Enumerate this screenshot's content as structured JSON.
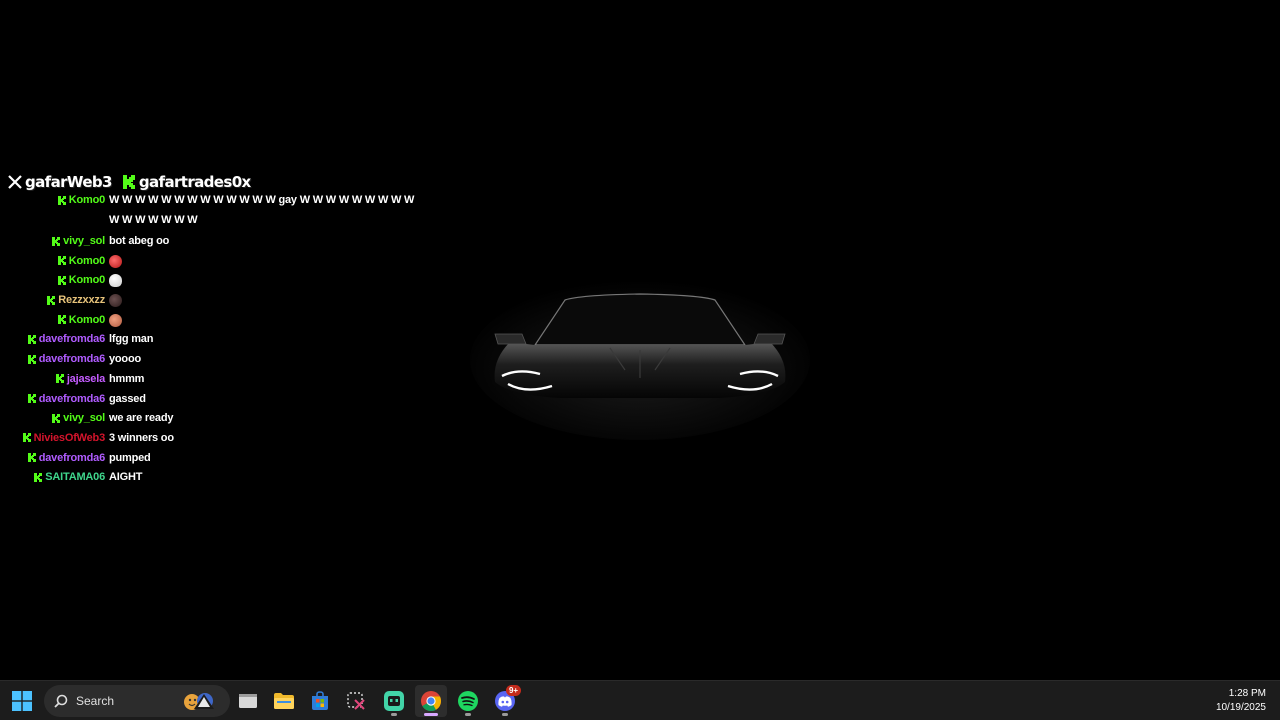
{
  "stream_header": {
    "x_handle": "gafarWeb3",
    "kick_handle": "gafartrades0x",
    "colors": {
      "kick_green": "#53fc18",
      "text": "#ffffff"
    }
  },
  "chat": {
    "messages": [
      {
        "user": "Komo0",
        "color": "#53fc18",
        "text": "W W W W W W W W W W W W W gay W W W W W W W W W",
        "partial": true
      },
      {
        "user": "",
        "color": "#ffffff",
        "text": "W W W W W W W",
        "continuation": true
      },
      {
        "user": "vivy_sol",
        "color": "#53fc18",
        "text": "bot abeg oo"
      },
      {
        "user": "Komo0",
        "color": "#53fc18",
        "text": "",
        "emote": "red-devil-emote"
      },
      {
        "user": "Komo0",
        "color": "#53fc18",
        "text": "",
        "emote": "ghost-emote"
      },
      {
        "user": "Rezzxxzz",
        "color": "#e6c27a",
        "text": "",
        "emote": "dark-face-emote"
      },
      {
        "user": "Komo0",
        "color": "#53fc18",
        "text": "",
        "emote": "face-emote"
      },
      {
        "user": "davefromda6",
        "color": "#b05cff",
        "text": "lfgg man"
      },
      {
        "user": "davefromda6",
        "color": "#b05cff",
        "text": "yoooo"
      },
      {
        "user": "jajasela",
        "color": "#c45cff",
        "text": "hmmm"
      },
      {
        "user": "davefromda6",
        "color": "#b05cff",
        "text": "gassed"
      },
      {
        "user": "vivy_sol",
        "color": "#53fc18",
        "text": "we are ready"
      },
      {
        "user": "NiviesOfWeb3",
        "color": "#d4142c",
        "text": "3 winners oo"
      },
      {
        "user": "davefromda6",
        "color": "#b05cff",
        "text": "pumped"
      },
      {
        "user": "SAITAMA06",
        "color": "#3fd68c",
        "text": "AIGHT"
      }
    ]
  },
  "taskbar": {
    "search_placeholder": "Search",
    "apps": [
      {
        "name": "file-explorer-window"
      },
      {
        "name": "file-explorer"
      },
      {
        "name": "microsoft-store"
      },
      {
        "name": "snipping-tool"
      },
      {
        "name": "app-running"
      },
      {
        "name": "chrome",
        "active": true
      },
      {
        "name": "spotify"
      },
      {
        "name": "discord",
        "badge": "9+"
      }
    ],
    "discord_badge": "9+",
    "clock_time": "1:28 PM",
    "clock_date": "10/19/2025"
  }
}
